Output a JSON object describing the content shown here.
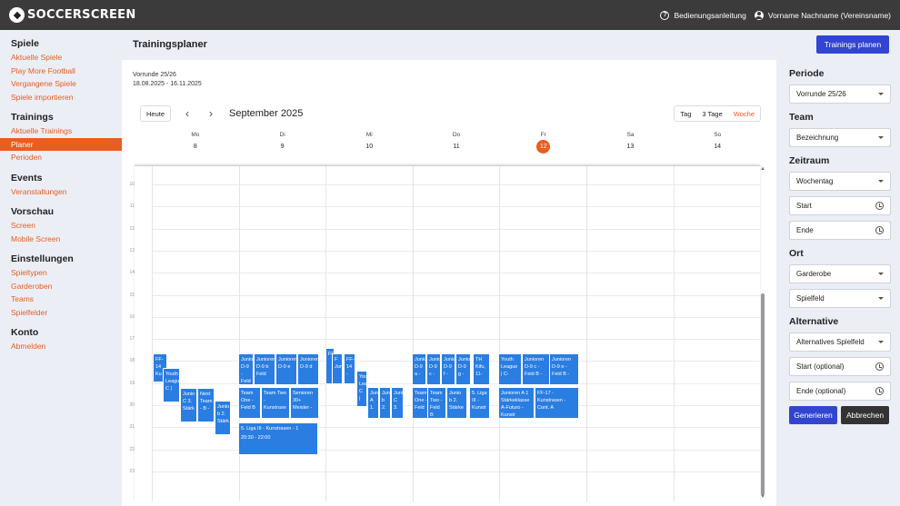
{
  "app": {
    "brand": "SOCCERSCREEN",
    "manual": "Bedienungsanleitung",
    "user": "Vorname Nachname (Vereinsname)"
  },
  "sidebar": [
    {
      "title": "Spiele",
      "items": [
        "Aktuelle Spiele",
        "Play More Football",
        "Vergangene Spiele",
        "Spiele importieren"
      ]
    },
    {
      "title": "Trainings",
      "items": [
        "Aktuelle Trainings",
        "Planer",
        "Perioden"
      ],
      "active": "Planer"
    },
    {
      "title": "Events",
      "items": [
        "Veranstaltungen"
      ]
    },
    {
      "title": "Vorschau",
      "items": [
        "Screen",
        "Mobile Screen"
      ]
    },
    {
      "title": "Einstellungen",
      "items": [
        "Spieltypen",
        "Garderoben",
        "Teams",
        "Spielfelder"
      ]
    },
    {
      "title": "Konto",
      "items": [
        "Abmelden"
      ]
    }
  ],
  "page": {
    "title": "Trainingsplaner",
    "plan_button": "Trainings planen"
  },
  "calendar": {
    "period_name": "Vorrunde 25/26",
    "period_range": "18.08.2025 - 16.11.2025",
    "today_button": "Heute",
    "prev": "‹",
    "next": "›",
    "month": "September 2025",
    "views": [
      "Tag",
      "3 Tage",
      "Woche"
    ],
    "active_view": "Woche",
    "days": [
      {
        "name": "Mo",
        "num": "8"
      },
      {
        "name": "Di",
        "num": "9"
      },
      {
        "name": "Mi",
        "num": "10"
      },
      {
        "name": "Do",
        "num": "11"
      },
      {
        "name": "Fr",
        "num": "12",
        "today": true
      },
      {
        "name": "Sa",
        "num": "13"
      },
      {
        "name": "So",
        "num": "14"
      }
    ],
    "hours": [
      "10",
      "11",
      "12",
      "13",
      "14",
      "15",
      "16",
      "17",
      "18",
      "19",
      "20",
      "21",
      "22",
      "23"
    ],
    "events": [
      {
        "text": "FF-14 Ku"
      },
      {
        "text": "Youth League C |"
      },
      {
        "text": "Junio C 3. Stärk"
      },
      {
        "text": "Next Team - B -"
      },
      {
        "text": "Junio b 2. Stärk"
      },
      {
        "text": "Junio D-9 - Feld"
      },
      {
        "text": "Junioren D-9 b Feld"
      },
      {
        "text": "Junioren D-9 e"
      },
      {
        "text": "Junioren D-9 d"
      },
      {
        "text": "Team One - Feld B"
      },
      {
        "text": "Team Two - Kunstrase"
      },
      {
        "text": "Senioren 30+ Meister -"
      },
      {
        "text": "5. Liga III - Kunstrasen - 1",
        "sub": "20:30 - 22:00"
      },
      {
        "text": "FF"
      },
      {
        "text": "F Jun"
      },
      {
        "text": "FF-14 -"
      },
      {
        "text": "You Lea C |"
      },
      {
        "text": "Juni A 1."
      },
      {
        "text": "Juni b 2."
      },
      {
        "text": "Juni C 3."
      },
      {
        "text": "Junio D-9 a -"
      },
      {
        "text": "Junio D-9 c -"
      },
      {
        "text": "Junio D-9 f -"
      },
      {
        "text": "Junio D-9 g -"
      },
      {
        "text": "TH Kifu, 11-"
      },
      {
        "text": "Team One - Feld"
      },
      {
        "text": "Team Two - Feld B"
      },
      {
        "text": "Junio b 2. Stärke"
      },
      {
        "text": "5. Liga III - Kunstr"
      },
      {
        "text": "Youth League | C-"
      },
      {
        "text": "Junioren D-9 c - Feld B -"
      },
      {
        "text": "Junioren D-9 e - Feld B -"
      },
      {
        "text": "Junioren A 1 Stärkeklasse A-Futuro - Kunstr"
      },
      {
        "text": "FF-17 - Kunstrasen - Cont. A"
      }
    ]
  },
  "filters": {
    "periode_label": "Periode",
    "periode_value": "Vorrunde 25/26",
    "team_label": "Team",
    "team_value": "Bezeichnung",
    "zeitraum_label": "Zeitraum",
    "wochentag": "Wochentag",
    "start": "Start",
    "ende": "Ende",
    "ort_label": "Ort",
    "garderobe": "Garderobe",
    "spielfeld": "Spielfeld",
    "alternative_label": "Alternative",
    "alt_spielfeld": "Alternatives Spielfeld",
    "alt_start": "Start (optional)",
    "alt_ende": "Ende (optional)",
    "generate": "Generieren",
    "cancel": "Abbrechen"
  }
}
